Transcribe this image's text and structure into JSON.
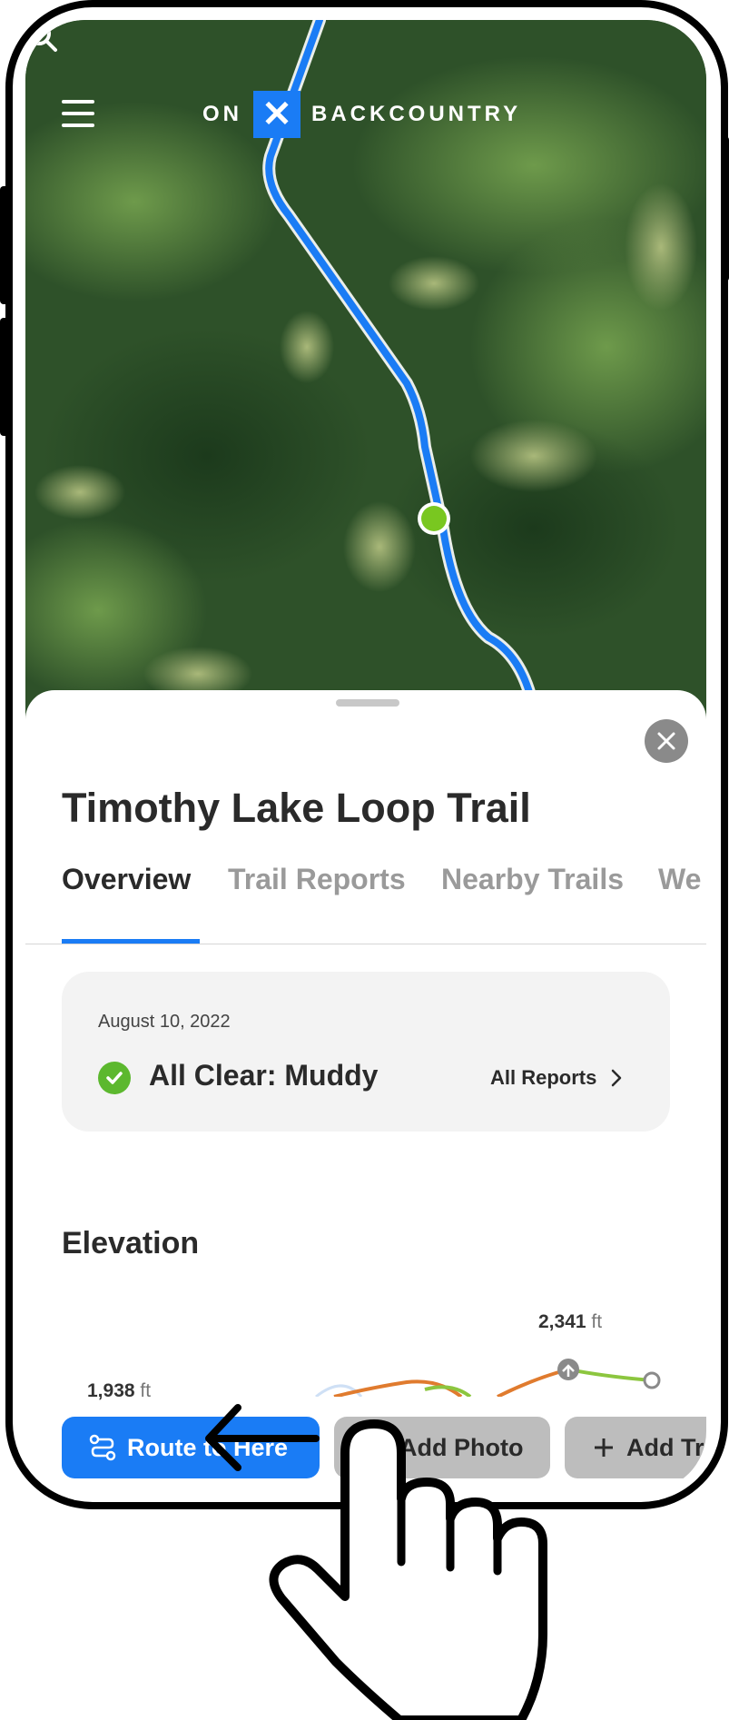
{
  "app": {
    "logo_left": "ON",
    "logo_mark": "✕",
    "logo_right": "BACKCOUNTRY"
  },
  "trail": {
    "title": "Timothy Lake Loop Trail"
  },
  "tabs": [
    {
      "label": "Overview",
      "active": true
    },
    {
      "label": "Trail Reports",
      "active": false
    },
    {
      "label": "Nearby Trails",
      "active": false
    },
    {
      "label": "We",
      "active": false
    }
  ],
  "report": {
    "date": "August 10, 2022",
    "status": "All Clear: Muddy",
    "link_label": "All Reports"
  },
  "elevation": {
    "heading": "Elevation",
    "max_value": "2,341",
    "max_unit": "ft",
    "min_value": "1,938",
    "min_unit": "ft"
  },
  "actions": {
    "route": "Route to Here",
    "photo": "Add Photo",
    "trip": "Add Tr"
  },
  "colors": {
    "accent": "#1a7cf5",
    "status_ok": "#5cb82e",
    "elev_green": "#8cc63f",
    "elev_orange": "#e07b2e"
  }
}
